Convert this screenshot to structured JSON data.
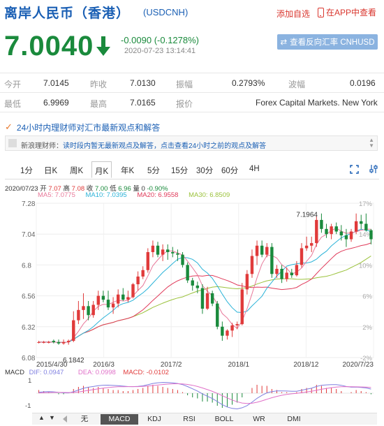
{
  "header": {
    "title": "离岸人民币（香港）",
    "symbol": "(USDCNH)",
    "add_favorite": "添加自选",
    "app_view": "在APP中查看"
  },
  "quote": {
    "price": "7.0040",
    "change": "-0.0090 (-0.1278%)",
    "timestamp": "2020-07-23 13:14:41",
    "reverse_button": "查看反向汇率 CNHUSD",
    "color": "#1a8a3c"
  },
  "stats": {
    "open_label": "今开",
    "open": "7.0145",
    "prev_close_label": "昨收",
    "prev_close": "7.0130",
    "amplitude_label": "振幅",
    "amplitude": "0.2793%",
    "volatility_label": "波幅",
    "volatility": "0.0196",
    "low_label": "最低",
    "low": "6.9969",
    "high_label": "最高",
    "high": "7.0165",
    "quote_label": "报价",
    "quote_source": "Forex Capital Markets. New York"
  },
  "news": {
    "headline": "24小时内理财师对汇市最新观点和解答",
    "prefix": "新浪理财师：",
    "body": "读时段内暂无最新观点及解答，点击查看24小时之前的观点及解答"
  },
  "tabs": [
    "1分",
    "日K",
    "周K",
    "月K",
    "年K",
    "5分",
    "15分",
    "30分",
    "60分",
    "4H"
  ],
  "active_tab": "月K",
  "ohlc": {
    "date": "2020/07/23",
    "open_label": "开",
    "open": "7.07",
    "high_label": "高",
    "high": "7.08",
    "close_label": "收",
    "close": "7.00",
    "low_label": "低",
    "low": "6.96",
    "vol_label": "量",
    "vol": "0",
    "pct": "-0.90%"
  },
  "ma": {
    "ma5": "MA5: 7.0775",
    "ma10": "MA10: 7.0395",
    "ma20": "MA20: 6.9558",
    "ma30": "MA30: 6.8509"
  },
  "macd": {
    "label": "MACD",
    "dif": "DIF: 0.0947",
    "dea": "DEA: 0.0998",
    "macd": "MACD: -0.0102"
  },
  "indicators": [
    "无",
    "MACD",
    "KDJ",
    "RSI",
    "BOLL",
    "WR",
    "DMI"
  ],
  "active_indicator": "MACD",
  "colors": {
    "up": "#e03a3a",
    "down": "#1a8a3c",
    "ma5": "#e8799a",
    "ma10": "#2bb3d8",
    "ma20": "#e03a5a",
    "ma30": "#9bc23c",
    "title": "#1a5fb4",
    "dif": "#7f7fe0",
    "dea": "#e070c8"
  },
  "chart_data": [
    {
      "type": "candlestick",
      "title": "",
      "y_ticks": [
        "7.28",
        "7.04",
        "6.8",
        "6.56",
        "6.32",
        "6.08"
      ],
      "y_range": [
        6.08,
        7.28
      ],
      "pct_ticks": [
        "17%",
        "14%",
        "10%",
        "6%",
        "2%",
        "-2%"
      ],
      "x_ticks": [
        "2015/4/30",
        "2016/3",
        "2017/2",
        "2018/1",
        "2018/12",
        "2020/7/23"
      ],
      "annotations": {
        "max": "7.1964",
        "min": "6.1842"
      },
      "ohlc_series": [
        [
          6.2,
          6.21,
          6.19,
          6.2
        ],
        [
          6.2,
          6.21,
          6.19,
          6.2
        ],
        [
          6.2,
          6.21,
          6.19,
          6.2
        ],
        [
          6.21,
          6.22,
          6.19,
          6.2
        ],
        [
          6.2,
          6.22,
          6.18,
          6.19
        ],
        [
          6.19,
          6.22,
          6.18,
          6.2
        ],
        [
          6.2,
          6.22,
          6.18,
          6.21
        ],
        [
          6.21,
          6.44,
          6.2,
          6.37
        ],
        [
          6.37,
          6.52,
          6.34,
          6.45
        ],
        [
          6.45,
          6.58,
          6.38,
          6.48
        ],
        [
          6.48,
          6.52,
          6.37,
          6.41
        ],
        [
          6.41,
          6.52,
          6.39,
          6.49
        ],
        [
          6.49,
          6.6,
          6.45,
          6.56
        ],
        [
          6.56,
          6.6,
          6.51,
          6.53
        ],
        [
          6.53,
          6.6,
          6.45,
          6.47
        ],
        [
          6.47,
          6.55,
          6.42,
          6.5
        ],
        [
          6.5,
          6.61,
          6.47,
          6.57
        ],
        [
          6.57,
          6.62,
          6.52,
          6.53
        ],
        [
          6.53,
          6.6,
          6.51,
          6.55
        ],
        [
          6.55,
          6.66,
          6.54,
          6.65
        ],
        [
          6.65,
          6.75,
          6.6,
          6.71
        ],
        [
          6.71,
          6.79,
          6.69,
          6.76
        ],
        [
          6.76,
          6.93,
          6.74,
          6.9
        ],
        [
          6.9,
          6.99,
          6.86,
          6.95
        ],
        [
          6.95,
          6.98,
          6.86,
          6.88
        ],
        [
          6.88,
          6.96,
          6.83,
          6.92
        ],
        [
          6.92,
          6.96,
          6.84,
          6.9
        ],
        [
          6.9,
          6.94,
          6.86,
          6.89
        ],
        [
          6.89,
          6.92,
          6.83,
          6.88
        ],
        [
          6.88,
          6.9,
          6.78,
          6.8
        ],
        [
          6.8,
          6.82,
          6.66,
          6.68
        ],
        [
          6.68,
          6.7,
          6.6,
          6.64
        ],
        [
          6.64,
          6.67,
          6.58,
          6.62
        ],
        [
          6.62,
          6.65,
          6.42,
          6.46
        ],
        [
          6.46,
          6.63,
          6.45,
          6.58
        ],
        [
          6.58,
          6.6,
          6.48,
          6.5
        ],
        [
          6.5,
          6.52,
          6.3,
          6.32
        ],
        [
          6.32,
          6.36,
          6.21,
          6.25
        ],
        [
          6.25,
          6.3,
          6.22,
          6.29
        ],
        [
          6.29,
          6.35,
          6.24,
          6.33
        ],
        [
          6.33,
          6.36,
          6.3,
          6.34
        ],
        [
          6.34,
          6.66,
          6.33,
          6.61
        ],
        [
          6.61,
          6.76,
          6.57,
          6.73
        ],
        [
          6.73,
          6.92,
          6.7,
          6.87
        ],
        [
          6.87,
          6.99,
          6.8,
          6.95
        ],
        [
          6.95,
          6.99,
          6.86,
          6.88
        ],
        [
          6.88,
          6.97,
          6.86,
          6.94
        ],
        [
          6.94,
          6.97,
          6.7,
          6.73
        ],
        [
          6.73,
          6.8,
          6.7,
          6.77
        ],
        [
          6.77,
          6.8,
          6.66,
          6.69
        ],
        [
          6.69,
          6.78,
          6.67,
          6.74
        ],
        [
          6.74,
          6.77,
          6.7,
          6.72
        ],
        [
          6.72,
          6.83,
          6.71,
          6.8
        ],
        [
          6.8,
          6.97,
          6.78,
          6.93
        ],
        [
          6.93,
          7.02,
          6.91,
          6.95
        ],
        [
          6.95,
          7.02,
          6.9,
          6.97
        ],
        [
          6.97,
          7.18,
          6.94,
          7.15
        ],
        [
          7.15,
          7.2,
          7.05,
          7.08
        ],
        [
          7.08,
          7.12,
          7.01,
          7.04
        ],
        [
          7.04,
          7.12,
          7.0,
          7.1
        ],
        [
          7.1,
          7.13,
          7.04,
          7.06
        ],
        [
          7.06,
          7.11,
          6.99,
          7.03
        ],
        [
          7.03,
          7.08,
          6.94,
          7.0
        ],
        [
          7.0,
          7.08,
          6.98,
          7.06
        ],
        [
          7.06,
          7.2,
          7.04,
          7.14
        ],
        [
          7.14,
          7.19,
          7.08,
          7.12
        ],
        [
          7.12,
          7.2,
          7.06,
          7.07
        ],
        [
          7.07,
          7.08,
          6.96,
          7.0
        ]
      ]
    },
    {
      "type": "bar",
      "title": "",
      "y_ticks": [
        "1",
        "-1"
      ],
      "macd_hist": [
        0.03,
        0.02,
        0.01,
        0.0,
        -0.01,
        -0.01,
        0.0,
        0.04,
        0.06,
        0.07,
        0.06,
        0.05,
        0.06,
        0.05,
        0.04,
        0.03,
        0.03,
        0.02,
        0.02,
        0.03,
        0.04,
        0.05,
        0.07,
        0.08,
        0.07,
        0.06,
        0.05,
        0.04,
        0.03,
        0.01,
        -0.02,
        -0.04,
        -0.05,
        -0.08,
        -0.08,
        -0.09,
        -0.12,
        -0.14,
        -0.13,
        -0.11,
        -0.09,
        -0.04,
        0.0,
        0.05,
        0.08,
        0.07,
        0.07,
        0.04,
        0.03,
        0.01,
        0.01,
        0.0,
        0.01,
        0.04,
        0.05,
        0.05,
        0.08,
        0.07,
        0.05,
        0.05,
        0.04,
        0.02,
        0.0,
        0.01,
        0.03,
        0.02,
        0.01,
        -0.01
      ]
    }
  ]
}
